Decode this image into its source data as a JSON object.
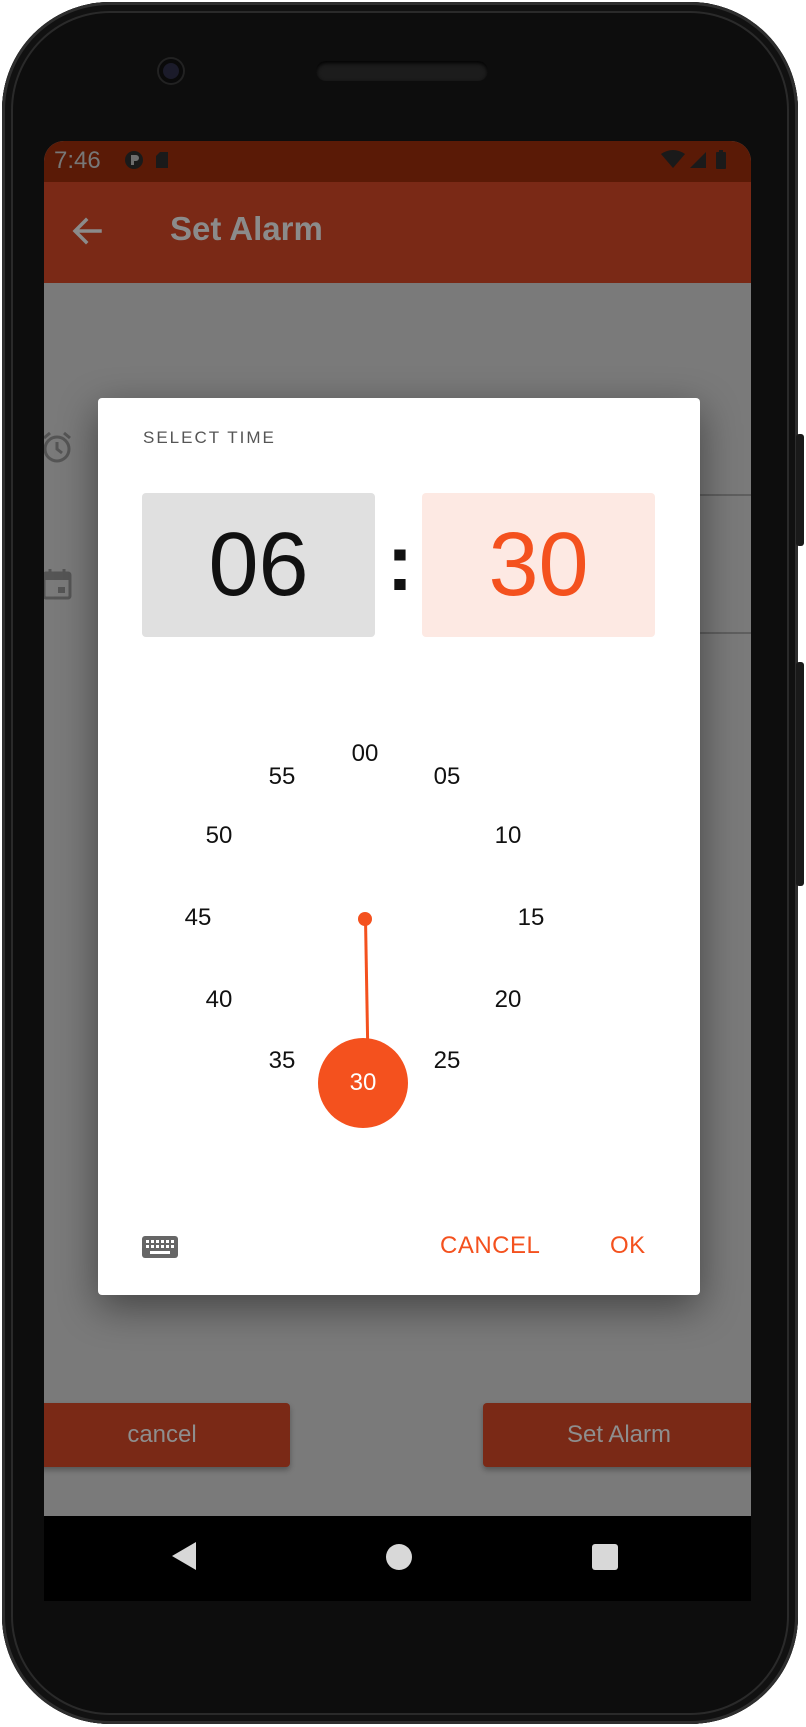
{
  "status_bar": {
    "time": "7:46"
  },
  "app_bar": {
    "title": "Set Alarm"
  },
  "dialog": {
    "title": "SELECT TIME",
    "hour": "06",
    "separator": ":",
    "minute": "30",
    "clock_numbers": [
      "00",
      "05",
      "10",
      "15",
      "20",
      "25",
      "35",
      "40",
      "45",
      "50",
      "55"
    ],
    "selected_minute": "30",
    "cancel_label": "CANCEL",
    "ok_label": "OK"
  },
  "bottom_buttons": {
    "cancel_label": "cancel",
    "set_label": "Set Alarm"
  },
  "colors": {
    "accent": "#f4511e",
    "app_bar": "#7a2916",
    "status_bar": "#5a1a06",
    "hour_bg": "#e0e0e0",
    "minute_bg": "#fde9e3"
  },
  "icons": [
    "back-arrow-icon",
    "alarm-clock-icon",
    "calendar-icon",
    "keyboard-icon",
    "nav-back-icon",
    "nav-home-icon",
    "nav-recents-icon",
    "wifi-icon",
    "signal-icon",
    "battery-icon"
  ]
}
